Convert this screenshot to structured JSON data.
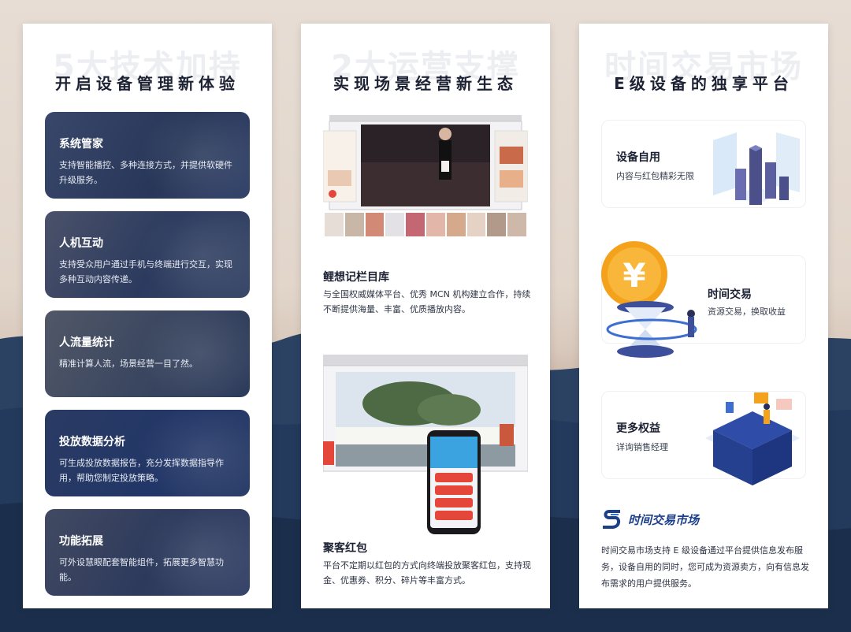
{
  "panels": [
    {
      "ghost_title": "5大技术加持",
      "title": "开启设备管理新体验",
      "cards": [
        {
          "title": "系统管家",
          "desc": "支持智能播控、多种连接方式，并提供软硬件升级服务。"
        },
        {
          "title": "人机互动",
          "desc": "支持受众用户通过手机与终端进行交互，实现多种互动内容传递。"
        },
        {
          "title": "人流量统计",
          "desc": "精准计算人流，场景经营一目了然。"
        },
        {
          "title": "投放数据分析",
          "desc": "可生成投放数据报告，充分发挥数据指导作用，帮助您制定投放策略。"
        },
        {
          "title": "功能拓展",
          "desc": "可外设慧眼配套智能组件，拓展更多智慧功能。"
        }
      ]
    },
    {
      "ghost_title": "2大运营支撑",
      "title": "实现场景经营新生态",
      "sections": [
        {
          "title": "鲤想记栏目库",
          "desc": "与全国权威媒体平台、优秀 MCN 机构建立合作，持续不断提供海量、丰富、优质播放内容。"
        },
        {
          "title": "聚客红包",
          "desc": "平台不定期以红包的方式向终端投放聚客红包，支持现金、优惠券、积分、碎片等丰富方式。"
        }
      ]
    },
    {
      "ghost_title": "时间交易市场",
      "title": "E级设备的独享平台",
      "features": [
        {
          "title": "设备自用",
          "desc": "内容与红包精彩无限"
        },
        {
          "title": "时间交易",
          "desc": "资源交易，换取收益"
        },
        {
          "title": "更多权益",
          "desc": "详询销售经理"
        }
      ],
      "brand": "时间交易市场",
      "desc": "时间交易市场支持 E 级设备通过平台提供信息发布服务，设备自用的同时，您可成为资源卖方，向有信息发布需求的用户提供服务。"
    }
  ],
  "colors": {
    "accent": "#1c3f8a",
    "dark": "#1c2233",
    "gold": "#f4a21b"
  }
}
